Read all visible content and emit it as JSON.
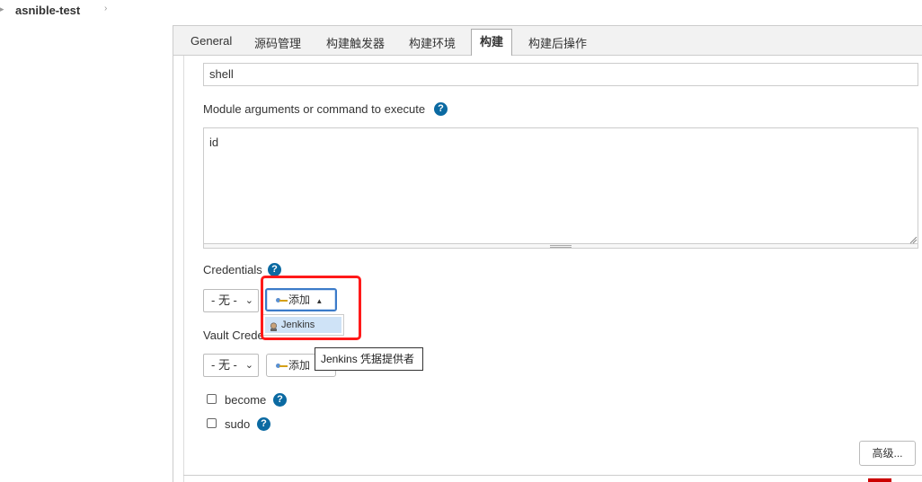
{
  "breadcrumb": {
    "left_caret": "▸",
    "project": "asnible-test",
    "right_caret": "›"
  },
  "tabs": [
    {
      "label": "General"
    },
    {
      "label": "源码管理"
    },
    {
      "label": "构建触发器"
    },
    {
      "label": "构建环境"
    },
    {
      "label": "构建"
    },
    {
      "label": "构建后操作"
    }
  ],
  "active_tab": "构建",
  "form": {
    "module_value": "shell",
    "args_label": "Module arguments or command to execute",
    "args_value": "id",
    "credentials_label": "Credentials",
    "credentials_selected": "- 无 -",
    "add_label": "添加",
    "dropdown_item": "Jenkins",
    "vault_label": "Vault Crede",
    "vault_selected": "- 无 -",
    "vault_add_label": "添加",
    "tooltip": "Jenkins 凭据提供者",
    "become_label": "become",
    "sudo_label": "sudo",
    "advanced_label": "高级..."
  },
  "icons": {
    "help": "?",
    "chevron": "⌄",
    "caret_up": "▲"
  },
  "colors": {
    "help_blue": "#0b6aa2",
    "highlight_red": "#ff1a1a",
    "menu_selected": "#cfe3f7"
  }
}
